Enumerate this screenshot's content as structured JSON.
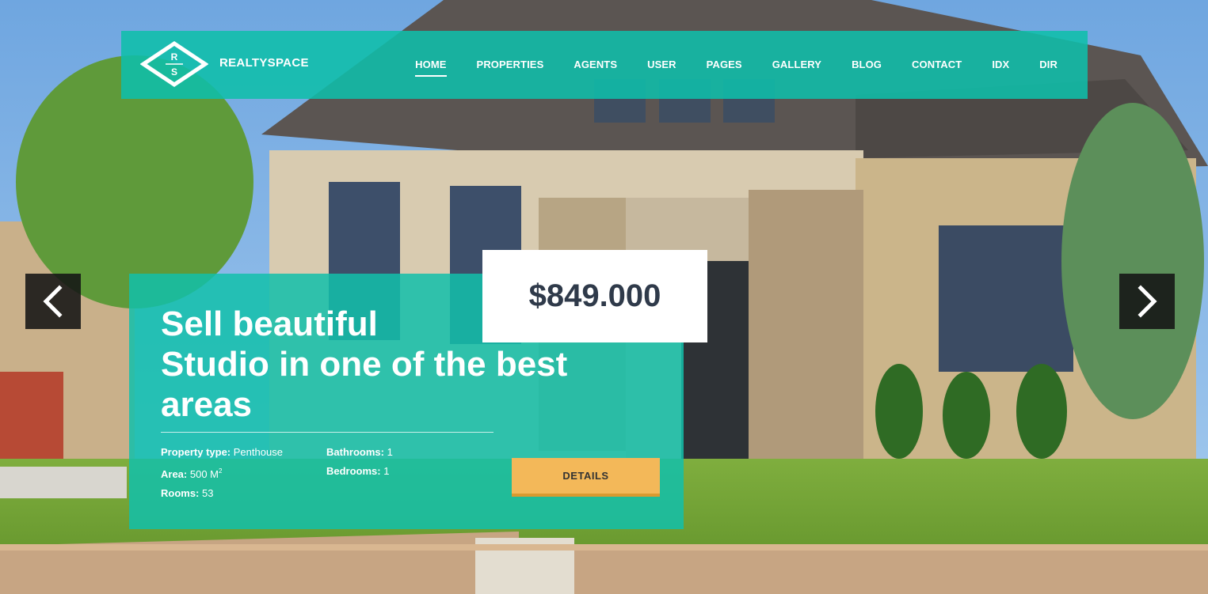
{
  "brand": {
    "logo_letters": [
      "R",
      "S"
    ],
    "name": "REALTYSPACE"
  },
  "nav": {
    "items": [
      "HOME",
      "PROPERTIES",
      "AGENTS",
      "USER",
      "PAGES",
      "GALLERY",
      "BLOG",
      "CONTACT",
      "IDX",
      "DIR"
    ],
    "active": "HOME"
  },
  "slider": {
    "prev_icon": "chevron-left-icon",
    "next_icon": "chevron-right-icon"
  },
  "listing": {
    "price": "$849.000",
    "title_lines": [
      "Sell beautiful",
      "Studio in one of the best",
      "areas"
    ],
    "specs": {
      "property_type_label": "Property type:",
      "property_type_value": "Penthouse",
      "area_label": "Area:",
      "area_value": "500 M",
      "area_sup": "2",
      "rooms_label": "Rooms:",
      "rooms_value": "53",
      "bathrooms_label": "Bathrooms:",
      "bathrooms_value": "1",
      "bedrooms_label": "Bedrooms:",
      "bedrooms_value": "1"
    },
    "details_label": "DETAILS"
  },
  "colors": {
    "teal": "#12c0aa",
    "button": "#f3b859",
    "price_text": "#2f3a4a"
  }
}
